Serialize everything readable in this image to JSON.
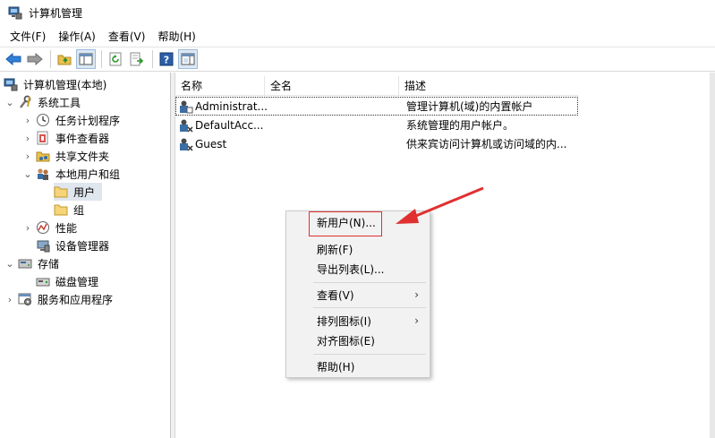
{
  "window": {
    "title": "计算机管理"
  },
  "menubar": {
    "items": [
      "文件(F)",
      "操作(A)",
      "查看(V)",
      "帮助(H)"
    ]
  },
  "tree": {
    "root": "计算机管理(本地)",
    "system_tools": "系统工具",
    "task_scheduler": "任务计划程序",
    "event_viewer": "事件查看器",
    "shared_folders": "共享文件夹",
    "local_users_groups": "本地用户和组",
    "users": "用户",
    "groups": "组",
    "performance": "性能",
    "device_manager": "设备管理器",
    "storage": "存储",
    "disk_management": "磁盘管理",
    "services_apps": "服务和应用程序"
  },
  "list": {
    "columns": [
      "名称",
      "全名",
      "描述"
    ],
    "rows": [
      {
        "name": "Administrat...",
        "fullname": "",
        "desc": "管理计算机(域)的内置帐户"
      },
      {
        "name": "DefaultAcc...",
        "fullname": "",
        "desc": "系统管理的用户帐户。"
      },
      {
        "name": "Guest",
        "fullname": "",
        "desc": "供来宾访问计算机或访问域的内..."
      }
    ]
  },
  "context_menu": {
    "new_user": "新用户(N)...",
    "refresh": "刷新(F)",
    "export": "导出列表(L)...",
    "view": "查看(V)",
    "arrange": "排列图标(I)",
    "align": "对齐图标(E)",
    "help": "帮助(H)",
    "submenu_glyph": "›"
  },
  "colors": {
    "annotation_red": "#e03030",
    "selection": "#dfe6ee"
  }
}
